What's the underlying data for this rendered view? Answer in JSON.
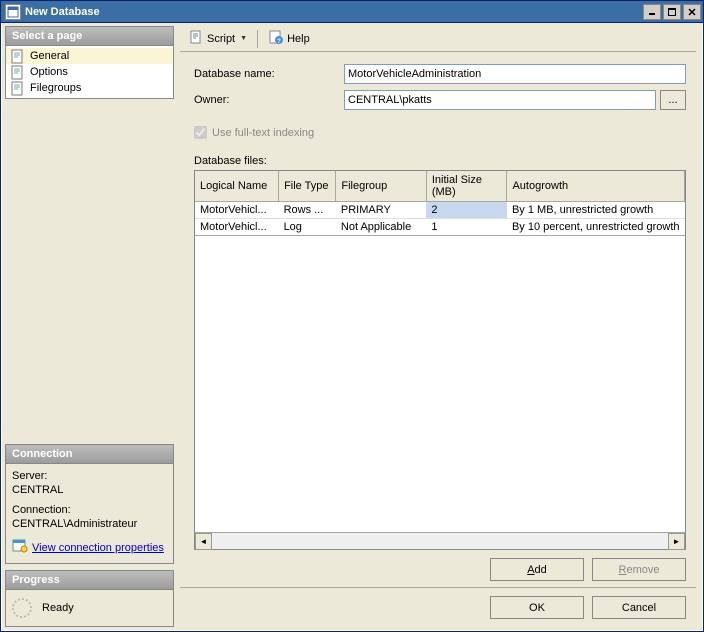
{
  "window": {
    "title": "New Database"
  },
  "sidebar": {
    "select_page": "Select a page",
    "items": [
      {
        "label": "General"
      },
      {
        "label": "Options"
      },
      {
        "label": "Filegroups"
      }
    ],
    "connection_header": "Connection",
    "server_label": "Server:",
    "server_value": "CENTRAL",
    "connection_label": "Connection:",
    "connection_value": "CENTRAL\\Administrateur",
    "view_props": "View connection properties",
    "progress_header": "Progress",
    "progress_status": "Ready"
  },
  "toolbar": {
    "script": "Script",
    "help": "Help"
  },
  "form": {
    "db_name_label": "Database name:",
    "db_name_value": "MotorVehicleAdministration",
    "owner_label": "Owner:",
    "owner_value": "CENTRAL\\pkatts",
    "fulltext_label": "Use full-text indexing",
    "files_label": "Database files:"
  },
  "grid": {
    "headers": [
      "Logical Name",
      "File Type",
      "Filegroup",
      "Initial Size (MB)",
      "Autogrowth"
    ],
    "rows": [
      {
        "logical": "MotorVehicl...",
        "type": "Rows ...",
        "filegroup": "PRIMARY",
        "size": "2",
        "autogrowth": "By 1 MB, unrestricted growth"
      },
      {
        "logical": "MotorVehicl...",
        "type": "Log",
        "filegroup": "Not Applicable",
        "size": "1",
        "autogrowth": "By 10 percent, unrestricted growth"
      }
    ]
  },
  "buttons": {
    "add": "Add",
    "remove": "Remove",
    "ok": "OK",
    "cancel": "Cancel",
    "browse": "..."
  }
}
